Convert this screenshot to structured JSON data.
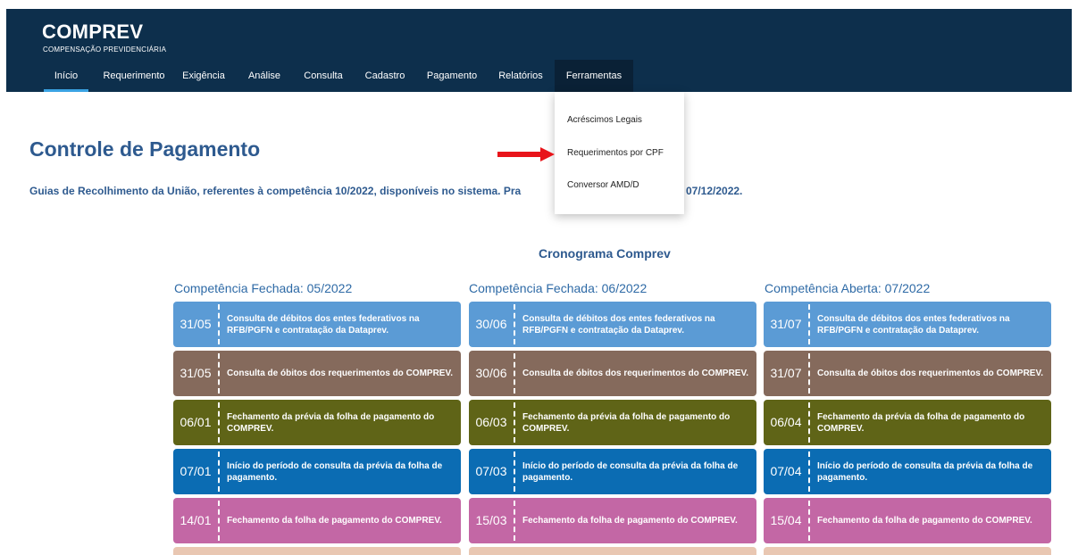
{
  "header": {
    "title": "COMPREV",
    "subtitle": "COMPENSAÇÃO PREVIDENCIÁRIA"
  },
  "nav": [
    {
      "label": "Início",
      "active": true
    },
    {
      "label": "Requerimento"
    },
    {
      "label": "Exigência"
    },
    {
      "label": "Análise"
    },
    {
      "label": "Consulta"
    },
    {
      "label": "Cadastro"
    },
    {
      "label": "Pagamento"
    },
    {
      "label": "Relatórios"
    },
    {
      "label": "Ferramentas",
      "open": true
    }
  ],
  "dropdown": {
    "items": [
      "Acréscimos Legais",
      "Requerimentos por CPF",
      "Conversor AMD/D"
    ]
  },
  "page": {
    "title": "Controle de Pagamento",
    "notice": "Guias de Recolhimento da União, referentes à competência 10/2022, disponíveis no sistema. Pra",
    "notice_end": "07/12/2022."
  },
  "schedule": {
    "title": "Cronograma Comprev",
    "columns": [
      {
        "heading": "Competência Fechada: 05/2022",
        "cards": [
          {
            "date": "31/05",
            "text": "Consulta de débitos dos entes federativos na RFB/PGFN e contratação da Dataprev.",
            "color": "#5b9bd5"
          },
          {
            "date": "31/05",
            "text": "Consulta de óbitos dos requerimentos do COMPREV.",
            "color": "#856a5c"
          },
          {
            "date": "06/01",
            "text": "Fechamento da prévia da folha de pagamento do COMPREV.",
            "color": "#5f6417"
          },
          {
            "date": "07/01",
            "text": "Início do período de consulta da prévia da folha de pagamento.",
            "color": "#0b6cb3"
          },
          {
            "date": "14/01",
            "text": "Fechamento da folha de pagamento do COMPREV.",
            "color": "#c367a5"
          }
        ]
      },
      {
        "heading": "Competência Fechada: 06/2022",
        "cards": [
          {
            "date": "30/06",
            "text": "Consulta de débitos dos entes federativos na RFB/PGFN e contratação da Dataprev.",
            "color": "#5b9bd5"
          },
          {
            "date": "30/06",
            "text": "Consulta de óbitos dos requerimentos do COMPREV.",
            "color": "#856a5c"
          },
          {
            "date": "06/03",
            "text": "Fechamento da prévia da folha de pagamento do COMPREV.",
            "color": "#5f6417"
          },
          {
            "date": "07/03",
            "text": "Início do período de consulta da prévia da folha de pagamento.",
            "color": "#0b6cb3"
          },
          {
            "date": "15/03",
            "text": "Fechamento da folha de pagamento do COMPREV.",
            "color": "#c367a5"
          }
        ]
      },
      {
        "heading": "Competência Aberta: 07/2022",
        "cards": [
          {
            "date": "31/07",
            "text": "Consulta de débitos dos entes federativos na RFB/PGFN e contratação da Dataprev.",
            "color": "#5b9bd5"
          },
          {
            "date": "31/07",
            "text": "Consulta de óbitos dos requerimentos do COMPREV.",
            "color": "#856a5c"
          },
          {
            "date": "06/04",
            "text": "Fechamento da prévia da folha de pagamento do COMPREV.",
            "color": "#5f6417"
          },
          {
            "date": "07/04",
            "text": "Início do período de consulta da prévia da folha de pagamento.",
            "color": "#0b6cb3"
          },
          {
            "date": "15/04",
            "text": "Fechamento da folha de pagamento do COMPREV.",
            "color": "#c367a5"
          }
        ]
      }
    ]
  },
  "colors": {
    "header_bg": "#0d2f4c",
    "nav_active_underline": "#3aa3e3",
    "heading_blue": "#2e5a8f",
    "arrow": "#e8141a"
  }
}
